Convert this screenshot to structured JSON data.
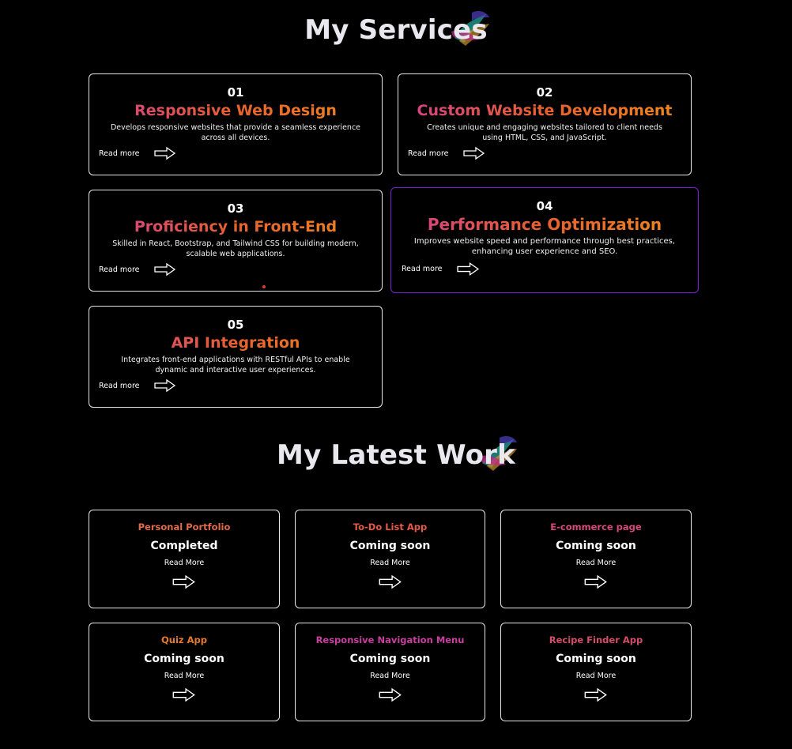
{
  "services": {
    "heading": "My Services",
    "items": [
      {
        "number": "01",
        "title": "Responsive Web Design",
        "description": "Develops responsive websites that provide a seamless experience across all devices.",
        "link": "Read more"
      },
      {
        "number": "02",
        "title": "Custom Website Development",
        "description": "Creates unique and engaging websites tailored to client needs using HTML, CSS, and JavaScript.",
        "link": "Read more"
      },
      {
        "number": "03",
        "title": "Proficiency in Front-End",
        "description": "Skilled in React, Bootstrap, and Tailwind CSS for building modern, scalable web applications.",
        "link": "Read more"
      },
      {
        "number": "04",
        "title": "Performance Optimization",
        "description": "Improves website speed and performance through best practices, enhancing user experience and SEO.",
        "link": "Read more"
      },
      {
        "number": "05",
        "title": "API Integration",
        "description": "Integrates front-end applications with RESTful APIs to enable dynamic and interactive user experiences.",
        "link": "Read more"
      }
    ]
  },
  "work": {
    "heading": "My Latest Work",
    "items": [
      {
        "title": "Personal Portfolio",
        "status": "Completed",
        "link": "Read More",
        "color": "#e06a4a"
      },
      {
        "title": "To-Do List App",
        "status": "Coming soon",
        "link": "Read More",
        "color": "#e65a45"
      },
      {
        "title": "E-commerce page",
        "status": "Coming soon",
        "link": "Read More",
        "color": "#d64a7a"
      },
      {
        "title": "Quiz App",
        "status": "Coming soon",
        "link": "Read More",
        "color": "#e57b2e"
      },
      {
        "title": "Responsive Navigation Menu",
        "status": "Coming soon",
        "link": "Read More",
        "color": "#c83fa0"
      },
      {
        "title": "Recipe Finder App",
        "status": "Coming soon",
        "link": "Read More",
        "color": "#d44e6a"
      }
    ]
  },
  "colors": {
    "accent_highlight": "#7b1fd6",
    "border": "#e6e6e6",
    "background": "#000000"
  },
  "icons": {
    "read_more": "right-arrow-icon",
    "heading_decoration": "paint-swirl-icon"
  }
}
